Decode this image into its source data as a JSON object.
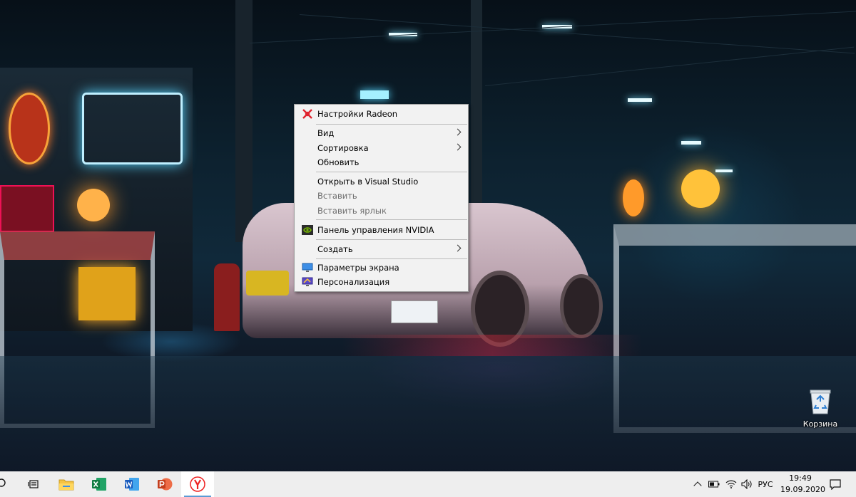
{
  "context_menu": {
    "items": [
      {
        "label": "Настройки Radeon",
        "icon": "radeon-icon"
      },
      {
        "label": "Вид",
        "submenu": true
      },
      {
        "label": "Сортировка",
        "submenu": true
      },
      {
        "label": "Обновить"
      },
      {
        "label": "Открыть в Visual Studio"
      },
      {
        "label": "Вставить",
        "disabled": true
      },
      {
        "label": "Вставить ярлык",
        "disabled": true
      },
      {
        "label": "Панель управления NVIDIA",
        "icon": "nvidia-icon"
      },
      {
        "label": "Создать",
        "submenu": true
      },
      {
        "label": "Параметры экрана",
        "icon": "display-settings-icon"
      },
      {
        "label": "Персонализация",
        "icon": "personalization-icon"
      }
    ]
  },
  "desktop": {
    "recycle_bin_label": "Корзина"
  },
  "taskbar": {
    "pinned": [
      "search-icon",
      "task-view-icon",
      "file-explorer-icon",
      "excel-icon",
      "word-icon",
      "powerpoint-icon",
      "yandex-browser-icon"
    ],
    "language": "РУС",
    "time": "19:49",
    "date": "19.09.2020"
  },
  "colors": {
    "menu_bg": "#f2f2f2",
    "taskbar_bg": "#eeeeee",
    "accent": "#5b9bd5"
  }
}
